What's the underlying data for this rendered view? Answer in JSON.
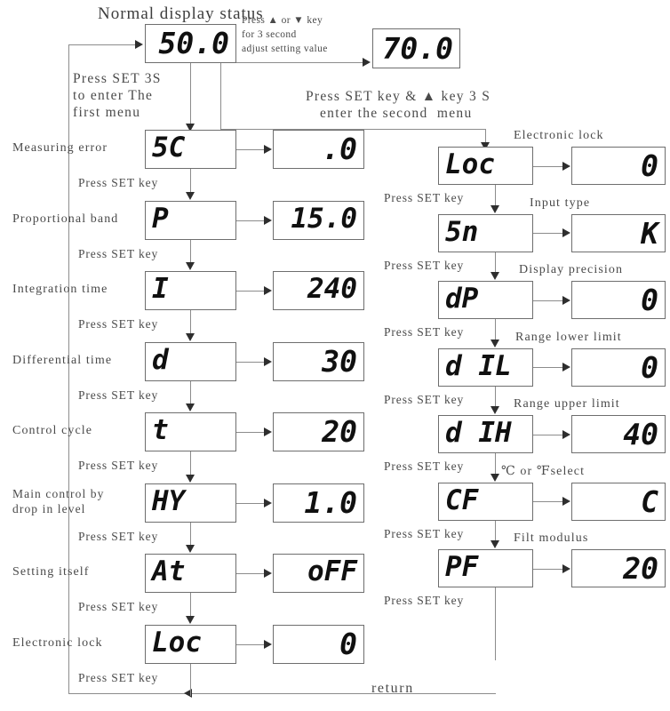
{
  "diagram": {
    "title": "Normal display status",
    "return_label": "return",
    "set_key_label": "Press SET key"
  },
  "normal_display": {
    "value": "50.0"
  },
  "adjust_note": {
    "line1": "Press ▲ or ▼ key",
    "line2": "for 3 second",
    "line3": "adjust setting value"
  },
  "adjusted_display": {
    "value": "70.0"
  },
  "first_menu_note": {
    "line1": "Press SET 3S",
    "line2": "to enter The",
    "line3": "first menu"
  },
  "second_menu_note": {
    "line1": "Press SET key & ▲ key 3 S",
    "line2": "enter the second  menu"
  },
  "first_menu": {
    "rows": [
      {
        "label": "Measuring error",
        "code": "5C",
        "value": ".0"
      },
      {
        "label": "Proportional band",
        "code": "P",
        "value": "15.0"
      },
      {
        "label": "Integration time",
        "code": "I",
        "value": "240"
      },
      {
        "label": "Differential time",
        "code": "d",
        "value": "30"
      },
      {
        "label": "Control cycle",
        "code": "t",
        "value": "20"
      },
      {
        "label": "Main control by\ndrop in level",
        "code": "HY",
        "value": "1.0"
      },
      {
        "label": "Setting itself",
        "code": "At",
        "value": "oFF"
      },
      {
        "label": "Electronic lock",
        "code": "Loc",
        "value": "0"
      }
    ]
  },
  "second_menu": {
    "rows": [
      {
        "label": "Electronic lock",
        "code": "Loc",
        "value": "0"
      },
      {
        "label": "Input type",
        "code": "5n",
        "value": "K"
      },
      {
        "label": "Display precision",
        "code": "dP",
        "value": "0"
      },
      {
        "label": "Range lower limit",
        "code": "d IL",
        "value": "0"
      },
      {
        "label": "Range upper limit",
        "code": "d IH",
        "value": "40"
      },
      {
        "label": "℃ or ℉select",
        "code": "CF",
        "value": "C"
      },
      {
        "label": "Filt modulus",
        "code": "PF",
        "value": "20"
      }
    ]
  },
  "colors": {
    "ink": "#101010",
    "line": "#8c8c8c",
    "text": "#4a4a4a",
    "box_border": "#6e6e6e"
  }
}
